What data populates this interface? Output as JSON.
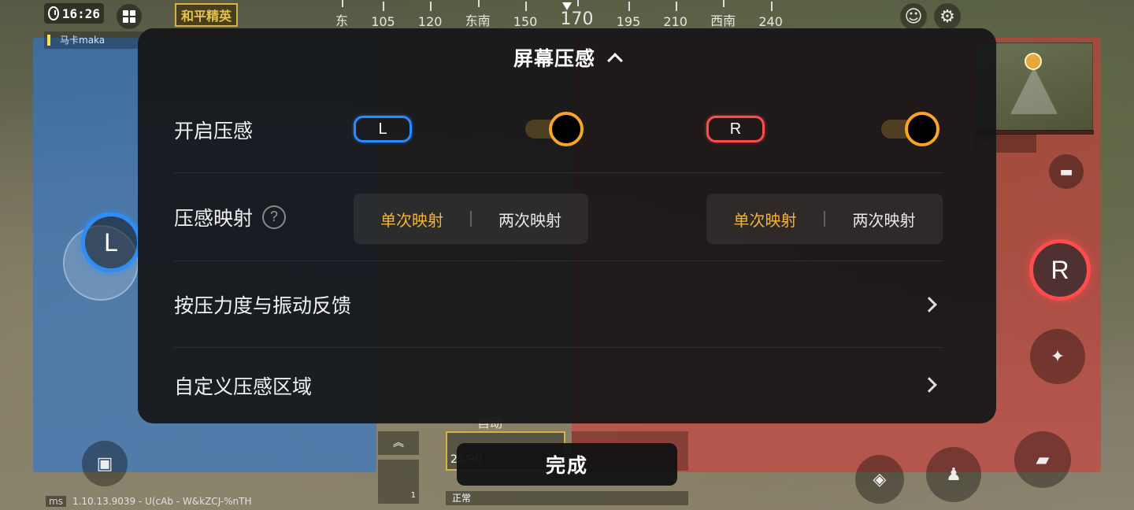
{
  "hud": {
    "time": "16:26",
    "game_logo": "和平精英",
    "player_name": "马卡maka",
    "compass": [
      "东",
      "105",
      "120",
      "东南",
      "150",
      "170",
      "195",
      "210",
      "西南",
      "240"
    ],
    "ammo": "25/90",
    "fire_mode": "自动",
    "knife_count": "1",
    "status": "正常",
    "bottom_info": "1.10.13.9039 - U(cAb - W&kZCJ-%nTH",
    "ping": "ms",
    "stream_tag": "-:--",
    "icons": [
      "stopwatch-icon",
      "grid-menu-icon",
      "emote-icon",
      "gear-icon",
      "chat-icon",
      "run-icon",
      "prone-icon",
      "crouch-icon",
      "reload-icon",
      "backpack-icon"
    ]
  },
  "panel": {
    "title": "屏幕压感",
    "rows": {
      "enable": {
        "label": "开启压感",
        "left_badge": "L",
        "right_badge": "R",
        "left_on": true,
        "right_on": true
      },
      "mapping": {
        "label": "压感映射",
        "help": "?",
        "left_options": [
          "单次映射",
          "两次映射"
        ],
        "right_options": [
          "单次映射",
          "两次映射"
        ],
        "left_selected": "单次映射",
        "right_selected": "单次映射"
      },
      "force": {
        "label": "按压力度与振动反馈"
      },
      "custom": {
        "label": "自定义压感区域"
      }
    }
  },
  "joysticks": {
    "left": "L",
    "right": "R"
  },
  "done_button": "完成",
  "colors": {
    "left_accent": "#2a8cff",
    "right_accent": "#ff4d4d",
    "active_option": "#f5b334",
    "toggle_on": "#f6a623"
  }
}
